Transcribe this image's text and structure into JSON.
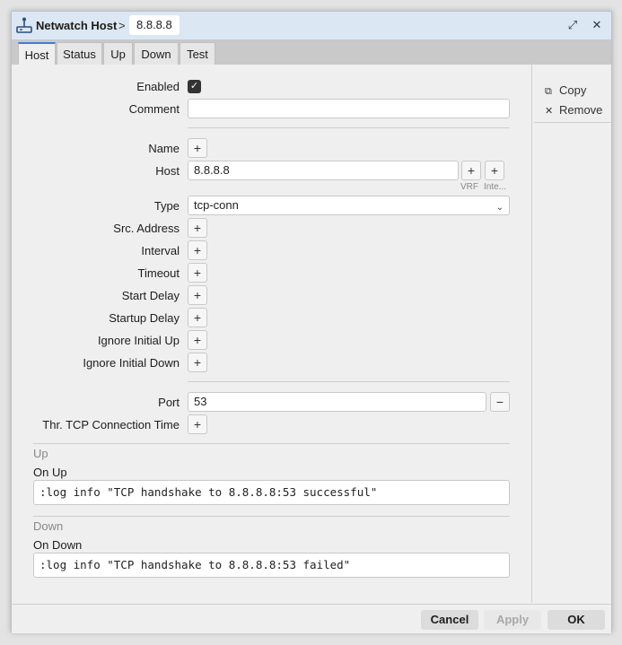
{
  "window": {
    "title": "Netwatch Host",
    "title_separator": ">",
    "host_badge": "8.8.8.8"
  },
  "tabs": [
    {
      "label": "Host",
      "active": true
    },
    {
      "label": "Status"
    },
    {
      "label": "Up"
    },
    {
      "label": "Down"
    },
    {
      "label": "Test"
    }
  ],
  "sidebar": {
    "copy": "Copy",
    "remove": "Remove"
  },
  "form": {
    "enabled": {
      "label": "Enabled",
      "checked": true
    },
    "comment": {
      "label": "Comment",
      "value": ""
    },
    "name": {
      "label": "Name"
    },
    "host": {
      "label": "Host",
      "value": "8.8.8.8",
      "vrf_label": "VRF",
      "inte_label": "Inte..."
    },
    "type": {
      "label": "Type",
      "value": "tcp-conn"
    },
    "src_address": {
      "label": "Src. Address"
    },
    "interval": {
      "label": "Interval"
    },
    "timeout": {
      "label": "Timeout"
    },
    "start_delay": {
      "label": "Start Delay"
    },
    "startup_delay": {
      "label": "Startup Delay"
    },
    "ignore_initial_up": {
      "label": "Ignore Initial Up"
    },
    "ignore_initial_down": {
      "label": "Ignore Initial Down"
    },
    "port": {
      "label": "Port",
      "value": "53"
    },
    "thr_tcp": {
      "label": "Thr. TCP Connection Time"
    }
  },
  "up_section": {
    "title": "Up",
    "on_up_label": "On Up",
    "on_up_value": ":log info \"TCP handshake to 8.8.8.8:53 successful\""
  },
  "down_section": {
    "title": "Down",
    "on_down_label": "On Down",
    "on_down_value": ":log info \"TCP handshake to 8.8.8.8:53 failed\""
  },
  "footer": {
    "cancel": "Cancel",
    "apply": "Apply",
    "ok": "OK"
  },
  "icons": {
    "plus": "+",
    "minus": "−",
    "check": "✓",
    "dropdown": "⌄",
    "restore": "⤢",
    "close": "✕",
    "copy": "⧉",
    "remove": "✕"
  },
  "colors": {
    "titlebar": "#dbe7f3",
    "tab_active_accent": "#3d7fd6",
    "background": "#efeff0"
  }
}
